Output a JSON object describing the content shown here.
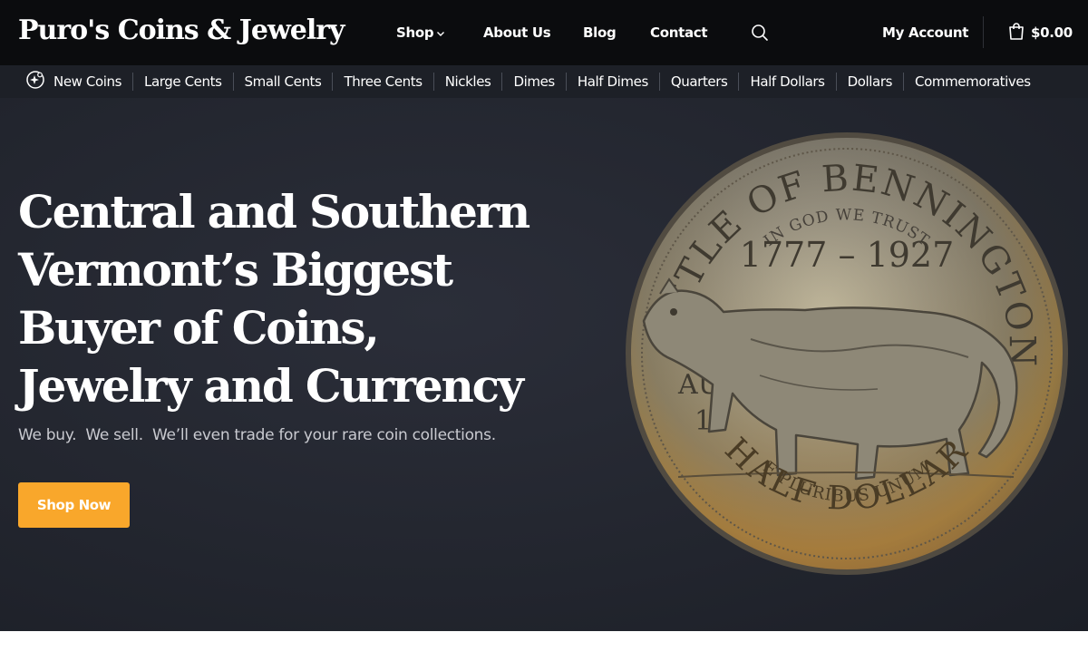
{
  "header": {
    "logo": "Puro's Coins & Jewelry",
    "nav": {
      "shop": "Shop",
      "about": "About Us",
      "blog": "Blog",
      "contact": "Contact",
      "account": "My Account"
    },
    "cart_total": "$0.00",
    "icons": {
      "search": "search-icon",
      "cart": "shopping-bag-icon",
      "chevron": "chevron-down-icon"
    }
  },
  "categories": [
    "New Coins",
    "Large Cents",
    "Small Cents",
    "Three Cents",
    "Nickles",
    "Dimes",
    "Half Dimes",
    "Quarters",
    "Half Dollars",
    "Dollars",
    "Commemoratives"
  ],
  "hero": {
    "title": "Central and Southern Vermont’s Biggest Buyer of Coins, Jewelry and Currency",
    "subtitle": "We buy.  We sell.  We’ll even trade for your rare coin collections.",
    "button": "Shop Now",
    "coin": {
      "top_text": "BATTLE OF BENNINGTON",
      "motto": "IN GOD WE TRUST",
      "years": "1777 – 1927",
      "date_month": "AUG.",
      "date_day": "16",
      "bottom_motto": "E PLURIBUS UNUM",
      "denomination": "HALF DOLLAR"
    }
  },
  "colors": {
    "header_bg": "#0b0c0e",
    "catbar_bg": "#1d2027",
    "hero_bg": "#23262f",
    "accent": "#f9a72b"
  }
}
